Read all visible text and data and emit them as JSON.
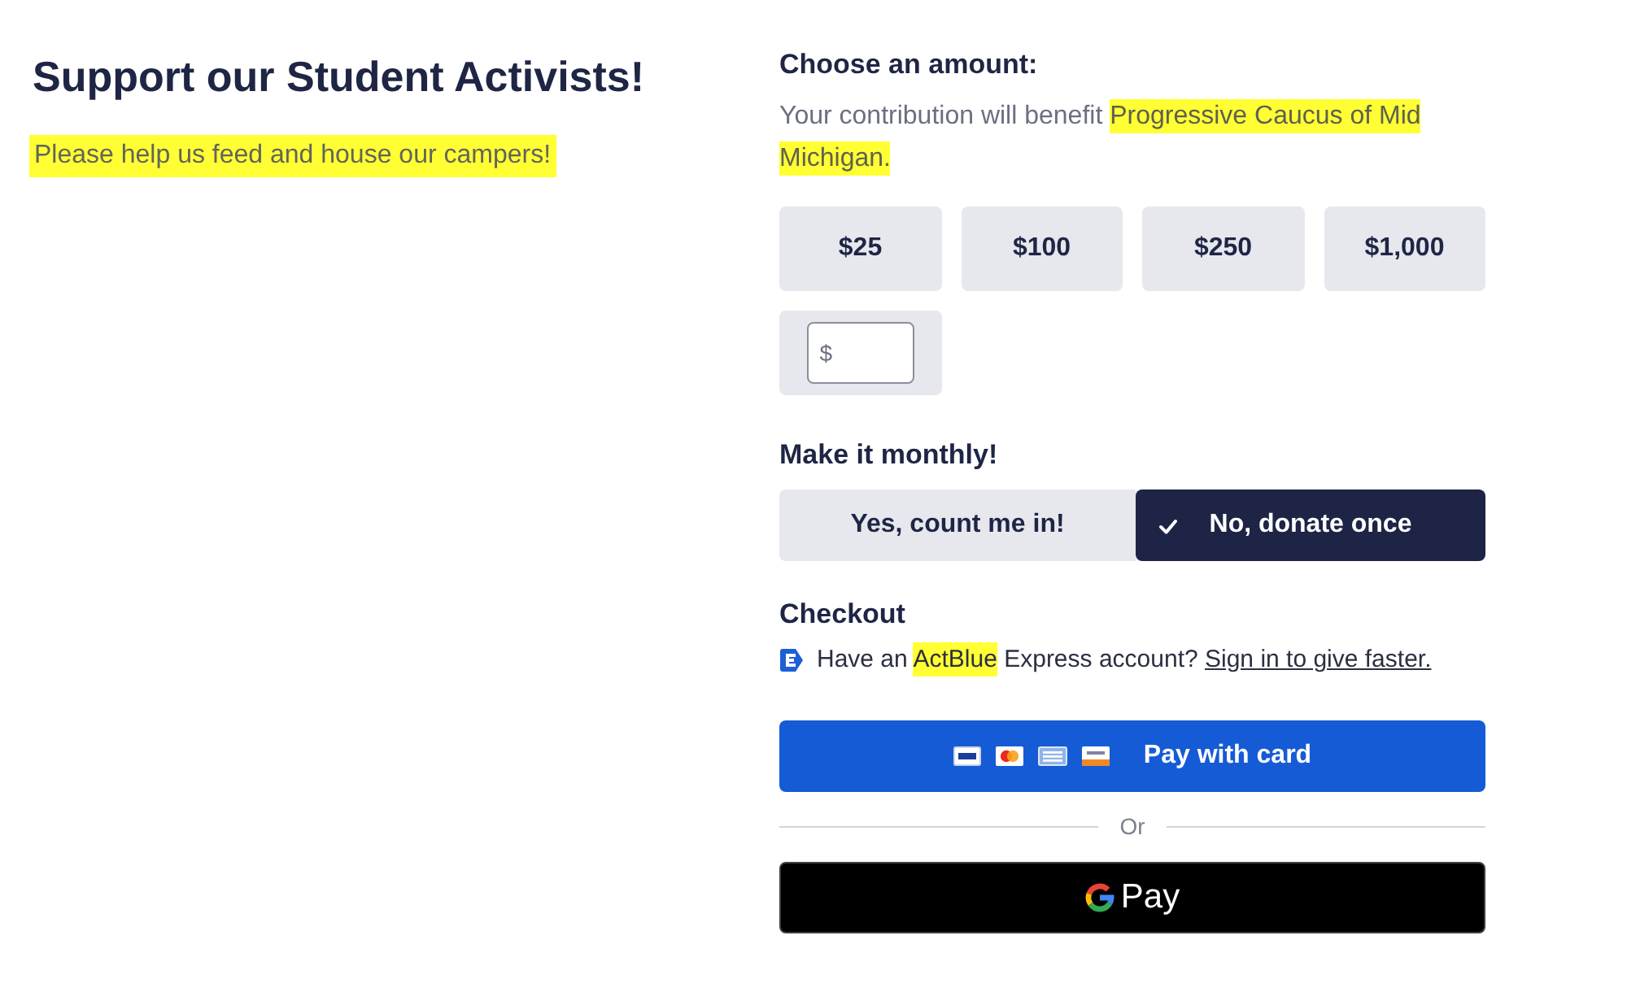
{
  "intro": {
    "title": "Support our Student Activists!",
    "message": {
      "text": "Please help us feed and house our campers!",
      "highlighted": true
    }
  },
  "amount": {
    "heading": "Choose an amount:",
    "note": [
      {
        "text": "Your contribution will benefit",
        "highlighted": false
      },
      {
        "text": "Progressive Caucus of Mid Michigan.",
        "highlighted": true
      }
    ],
    "options": [
      {
        "label": "$25",
        "selected": false
      },
      {
        "label": "$100",
        "selected": false
      },
      {
        "label": "$250",
        "selected": false
      },
      {
        "label": "$1,000",
        "selected": false
      }
    ],
    "custom": {
      "prefix": "$"
    }
  },
  "monthly": {
    "heading": "Make it monthly!",
    "options": [
      {
        "label": "Yes, count me in!",
        "selected": false
      },
      {
        "label": "No, donate once",
        "selected": true
      }
    ]
  },
  "checkout": {
    "heading": "Checkout",
    "express": {
      "parts": [
        {
          "text": "Have an",
          "highlighted": false
        },
        {
          "text": "ActBlue",
          "highlighted": true
        },
        {
          "text": "Express account?",
          "highlighted": false
        }
      ],
      "link": "Sign in to give faster."
    },
    "card_button": "Pay with card",
    "separator": "Or",
    "wallet_button": "Pay"
  }
}
